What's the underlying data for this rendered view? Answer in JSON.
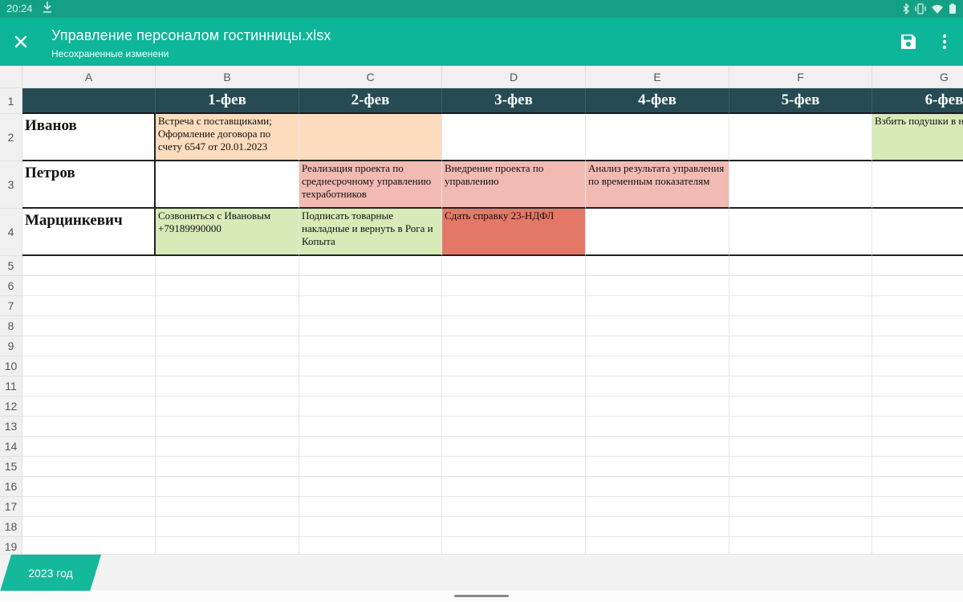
{
  "status": {
    "time": "20:24"
  },
  "app": {
    "title": "Управление персоналом гостинницы.xlsx",
    "subtitle": "Несохраненные изменени"
  },
  "columns": [
    "A",
    "B",
    "C",
    "D",
    "E",
    "F",
    "G"
  ],
  "rows": [
    "1",
    "2",
    "3",
    "4",
    "5",
    "6",
    "7",
    "8",
    "9",
    "10",
    "11",
    "12",
    "13",
    "14",
    "15",
    "16",
    "17",
    "18",
    "19"
  ],
  "dates": [
    "1-фев",
    "2-фев",
    "3-фев",
    "4-фев",
    "5-фев",
    "6-фев"
  ],
  "people": [
    {
      "name": "Иванов",
      "tasks": {
        "B": {
          "text": "Встреча с поставщиками; Оформление договора по счету 6547 от 20.01.2023",
          "color": "#fcdcbc"
        },
        "C": {
          "text": "",
          "color": "#fcdcbc"
        },
        "G": {
          "text": "Взбить подушки в н",
          "color": "#d7eab8"
        }
      }
    },
    {
      "name": "Петров",
      "tasks": {
        "C": {
          "text": "Реализация проекта по среднесрочному управлению техработников",
          "color": "#f1bab2"
        },
        "D": {
          "text": "Внедрение проекта по управлению",
          "color": "#f1bab2"
        },
        "E": {
          "text": "Анализ результата управления по временным показателям",
          "color": "#f1bab2"
        }
      }
    },
    {
      "name": "Марцинкевич",
      "tasks": {
        "B": {
          "text": "Созвониться с Ивановым +79189990000",
          "color": "#d7eab8"
        },
        "C": {
          "text": "Подписать товарные накладные и вернуть в Рога и Копыта",
          "color": "#d7eab8"
        },
        "D": {
          "text": "Сдать справку 23-НДФЛ",
          "color": "#e47868"
        }
      }
    }
  ],
  "sheet_tab": "2023 год",
  "colors": {
    "appbar": "#0db698",
    "statusbar": "#14a085",
    "header_row": "#274b53",
    "sheet_tab": "#15b89b"
  }
}
